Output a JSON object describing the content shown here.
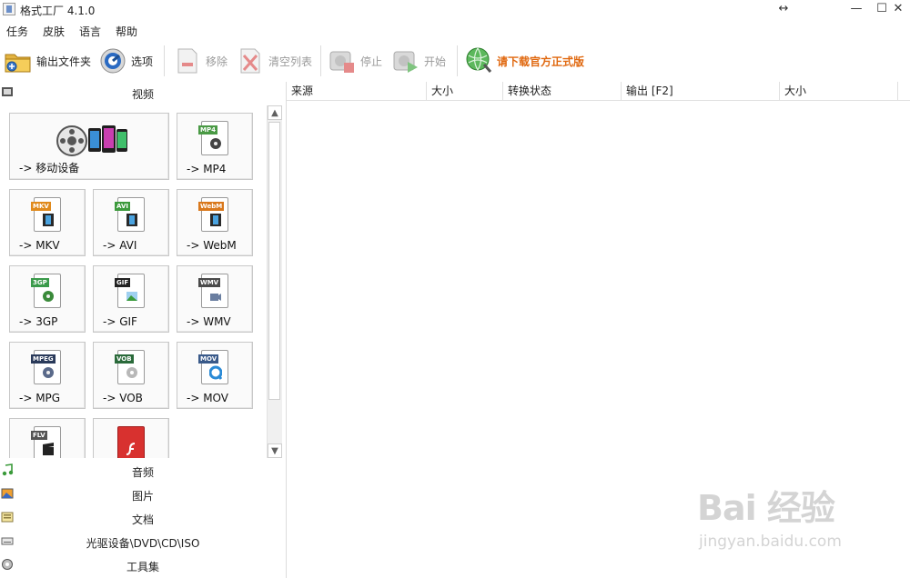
{
  "window": {
    "title": "格式工厂 4.1.0",
    "resize_glyph": "↔",
    "minimize_glyph": "—",
    "maximize_glyph": "☐",
    "close_glyph": "✕"
  },
  "menu": [
    "任务",
    "皮肤",
    "语言",
    "帮助"
  ],
  "toolbar": {
    "output_folder": "输出文件夹",
    "options": "选项",
    "remove": "移除",
    "clear_list": "清空列表",
    "stop": "停止",
    "start": "开始",
    "promo": "请下载官方正式版"
  },
  "categories": {
    "video": "视频",
    "audio": "音频",
    "image": "图片",
    "document": "文档",
    "optical": "光驱设备\\DVD\\CD\\ISO",
    "tools": "工具集"
  },
  "video_tiles": [
    {
      "label": "-> 移动设备",
      "icon": "mobile-device-icon"
    },
    {
      "label": "-> MP4",
      "tag": "MP4",
      "tag_color": "#4a9a45",
      "icon": "film-reel-icon"
    },
    {
      "label": "-> MKV",
      "tag": "MKV",
      "tag_color": "#e08a1c",
      "icon": "film-strip-icon"
    },
    {
      "label": "-> AVI",
      "tag": "AVI",
      "tag_color": "#3c9a3c",
      "icon": "film-strip-icon"
    },
    {
      "label": "-> WebM",
      "tag": "WebM",
      "tag_color": "#d9781c",
      "icon": "film-strip-icon"
    },
    {
      "label": "-> 3GP",
      "tag": "3GP",
      "tag_color": "#3a9a4a",
      "icon": "film-reel-icon"
    },
    {
      "label": "-> GIF",
      "tag": "GIF",
      "tag_color": "#222222",
      "icon": "picture-icon"
    },
    {
      "label": "-> WMV",
      "tag": "WMV",
      "tag_color": "#4a4a4a",
      "icon": "camera-icon"
    },
    {
      "label": "-> MPG",
      "tag": "MPEG",
      "tag_color": "#2a3a5a",
      "icon": "film-reel-icon"
    },
    {
      "label": "-> VOB",
      "tag": "VOB",
      "tag_color": "#2a6a3a",
      "icon": "disc-icon"
    },
    {
      "label": "-> MOV",
      "tag": "MOV",
      "tag_color": "#3a5a8a",
      "icon": "quicktime-icon"
    },
    {
      "label": "",
      "tag": "FLV",
      "tag_color": "#555555",
      "icon": "clapper-icon"
    },
    {
      "label": "",
      "tag": "SWF",
      "tag_color": "#cc2222",
      "icon": "flash-icon"
    }
  ],
  "list_columns": [
    "来源",
    "大小",
    "转换状态",
    "输出 [F2]",
    "大小"
  ],
  "watermark": {
    "brand": "Bai 经验",
    "site": "jingyan.baidu.com"
  }
}
